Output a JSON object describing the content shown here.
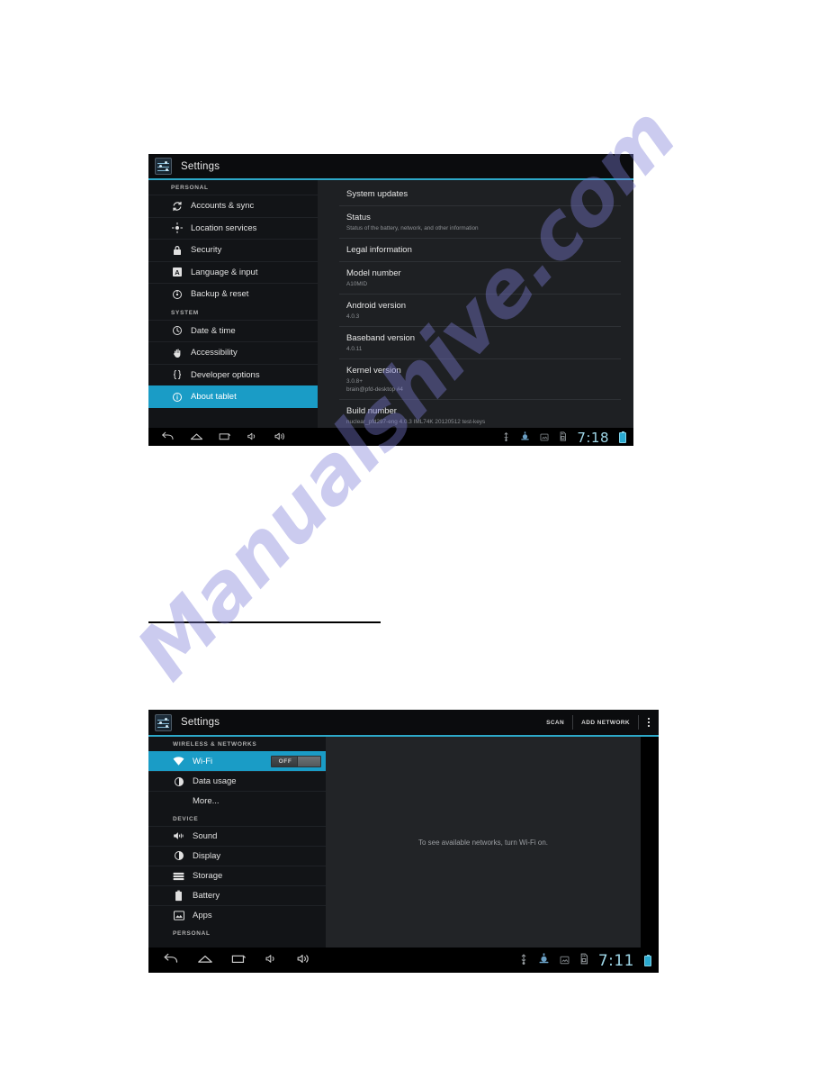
{
  "page": {
    "background_color": "#ffffff",
    "watermark_text": "Manualshive.com",
    "watermark_color": "#7e7ed6"
  },
  "screenshot_about": {
    "action_bar": {
      "app_icon": "settings-icon",
      "title": "Settings"
    },
    "accent_color": "#2da8c8",
    "sidebar": {
      "sections": [
        {
          "header": "PERSONAL",
          "items": [
            {
              "label": "Accounts & sync",
              "icon": "sync-icon",
              "selected": false
            },
            {
              "label": "Location services",
              "icon": "location-icon",
              "selected": false
            },
            {
              "label": "Security",
              "icon": "lock-icon",
              "selected": false
            },
            {
              "label": "Language & input",
              "icon": "language-icon",
              "selected": false
            },
            {
              "label": "Backup & reset",
              "icon": "backup-restore-icon",
              "selected": false
            }
          ]
        },
        {
          "header": "SYSTEM",
          "items": [
            {
              "label": "Date & time",
              "icon": "clock-icon",
              "selected": false
            },
            {
              "label": "Accessibility",
              "icon": "hand-icon",
              "selected": false
            },
            {
              "label": "Developer options",
              "icon": "braces-icon",
              "selected": false
            },
            {
              "label": "About tablet",
              "icon": "info-icon",
              "selected": true
            }
          ]
        }
      ]
    },
    "detail_rows": [
      {
        "title": "System updates",
        "subtitle": ""
      },
      {
        "title": "Status",
        "subtitle": "Status of the battery, network, and other information"
      },
      {
        "title": "Legal information",
        "subtitle": ""
      },
      {
        "title": "Model number",
        "subtitle": "A10MID"
      },
      {
        "title": "Android version",
        "subtitle": "4.0.3"
      },
      {
        "title": "Baseband version",
        "subtitle": "4.0.11"
      },
      {
        "title": "Kernel version",
        "subtitle": "3.0.8+\nbrain@pfd-desktop #4"
      },
      {
        "title": "Build number",
        "subtitle": "nuclear_pfd297-eng 4.0.3 IML74K 20120512 test-keys"
      }
    ],
    "system_bar": {
      "left_icons": [
        "back-icon",
        "home-icon",
        "recents-icon",
        "volume-down-icon",
        "volume-up-icon"
      ],
      "right_icons": [
        "usb-icon",
        "settings-status-icon",
        "screenshot-icon",
        "sd-card-icon"
      ],
      "clock": "7:18",
      "battery": "battery-icon"
    }
  },
  "screenshot_wifi": {
    "action_bar": {
      "app_icon": "settings-icon",
      "title": "Settings",
      "scan_label": "SCAN",
      "add_network_label": "ADD NETWORK",
      "overflow": "overflow-menu-icon"
    },
    "accent_color": "#2da8c8",
    "sidebar": {
      "sections": [
        {
          "header": "WIRELESS & NETWORKS",
          "items": [
            {
              "label": "Wi-Fi",
              "icon": "wifi-icon",
              "selected": true,
              "toggle": "OFF"
            },
            {
              "label": "Data usage",
              "icon": "data-usage-icon",
              "selected": false
            },
            {
              "label": "More...",
              "icon": "",
              "selected": false
            }
          ]
        },
        {
          "header": "DEVICE",
          "items": [
            {
              "label": "Sound",
              "icon": "sound-icon",
              "selected": false
            },
            {
              "label": "Display",
              "icon": "display-icon",
              "selected": false
            },
            {
              "label": "Storage",
              "icon": "storage-icon",
              "selected": false
            },
            {
              "label": "Battery",
              "icon": "battery-icon",
              "selected": false
            },
            {
              "label": "Apps",
              "icon": "apps-icon",
              "selected": false
            }
          ]
        },
        {
          "header": "PERSONAL",
          "items": []
        }
      ]
    },
    "content": {
      "empty_message": "To see available networks, turn Wi-Fi on."
    },
    "system_bar": {
      "left_icons": [
        "back-icon",
        "home-icon",
        "recents-icon",
        "volume-down-icon",
        "volume-up-icon"
      ],
      "right_icons": [
        "usb-icon",
        "settings-status-icon",
        "screenshot-icon",
        "sd-card-icon"
      ],
      "clock": "7:11",
      "battery": "battery-icon"
    }
  }
}
